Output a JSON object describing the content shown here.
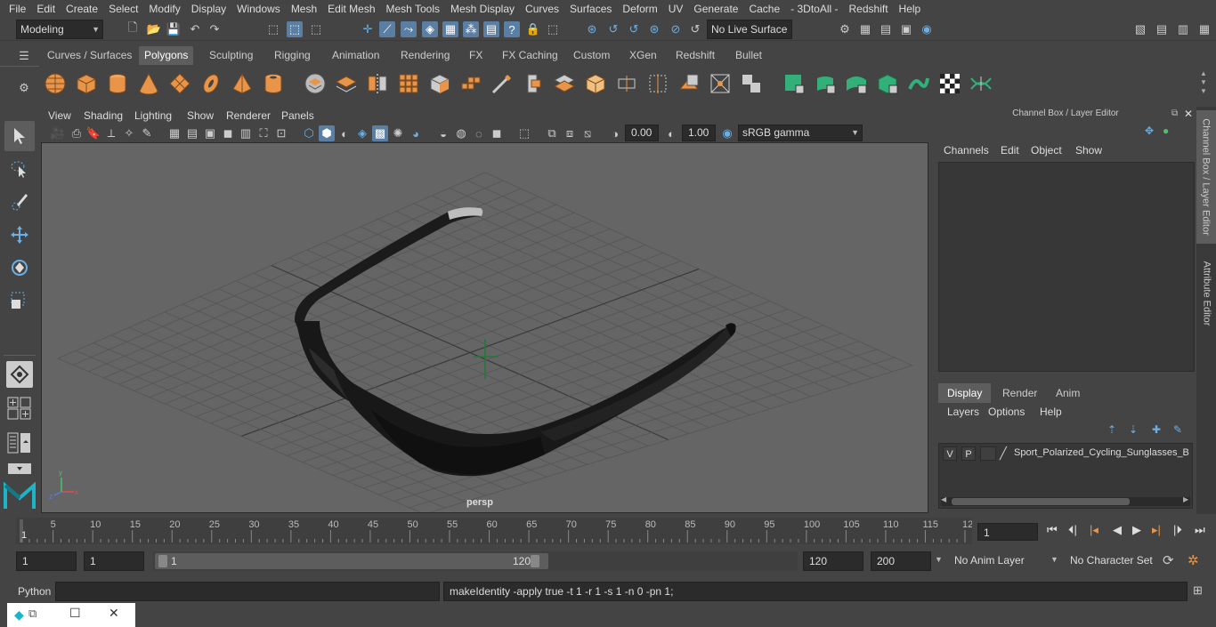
{
  "menu": [
    "File",
    "Edit",
    "Create",
    "Select",
    "Modify",
    "Display",
    "Windows",
    "Mesh",
    "Edit Mesh",
    "Mesh Tools",
    "Mesh Display",
    "Curves",
    "Surfaces",
    "Deform",
    "UV",
    "Generate",
    "Cache",
    "- 3DtoAll -",
    "Redshift",
    "Help"
  ],
  "status": {
    "mode": "Modeling",
    "live_surface": "No Live Surface"
  },
  "shelf_tabs": [
    "Curves / Surfaces",
    "Polygons",
    "Sculpting",
    "Rigging",
    "Animation",
    "Rendering",
    "FX",
    "FX Caching",
    "Custom",
    "XGen",
    "Redshift",
    "Bullet"
  ],
  "shelf_active": "Polygons",
  "viewport": {
    "menu": [
      "View",
      "Shading",
      "Lighting",
      "Show",
      "Renderer",
      "Panels"
    ],
    "exposure": "0.00",
    "gamma": "1.00",
    "colorspace": "sRGB gamma",
    "camera": "persp"
  },
  "channel_box": {
    "title": "Channel Box / Layer Editor",
    "menu": [
      "Channels",
      "Edit",
      "Object",
      "Show"
    ],
    "layer_tabs": [
      "Display",
      "Render",
      "Anim"
    ],
    "layer_tab_active": "Display",
    "layer_menu": [
      "Layers",
      "Options",
      "Help"
    ],
    "layer": {
      "v": "V",
      "p": "P",
      "name": "Sport_Polarized_Cycling_Sunglasses_B"
    }
  },
  "side_tabs": [
    "Channel Box / Layer Editor",
    "Attribute Editor"
  ],
  "timeline": {
    "ticks": [
      "5",
      "10",
      "15",
      "20",
      "25",
      "30",
      "35",
      "40",
      "45",
      "50",
      "55",
      "60",
      "65",
      "70",
      "75",
      "80",
      "85",
      "90",
      "95",
      "100",
      "105",
      "110",
      "115",
      "12"
    ],
    "start_marker": "1",
    "current_frame": "1"
  },
  "range": {
    "start": "1",
    "playback_start": "1",
    "slider_start": "1",
    "slider_end": "120",
    "playback_end": "120",
    "end": "200",
    "anim_layer": "No Anim Layer",
    "char_set": "No Character Set"
  },
  "cmd": {
    "lang": "Python",
    "result": "makeIdentity -apply true -t 1 -r 1 -s 1 -n 0 -pn 1;"
  },
  "colors": {
    "accent": "#5b7ea3",
    "poly_orange": "#e8954a",
    "green": "#33b07a"
  }
}
